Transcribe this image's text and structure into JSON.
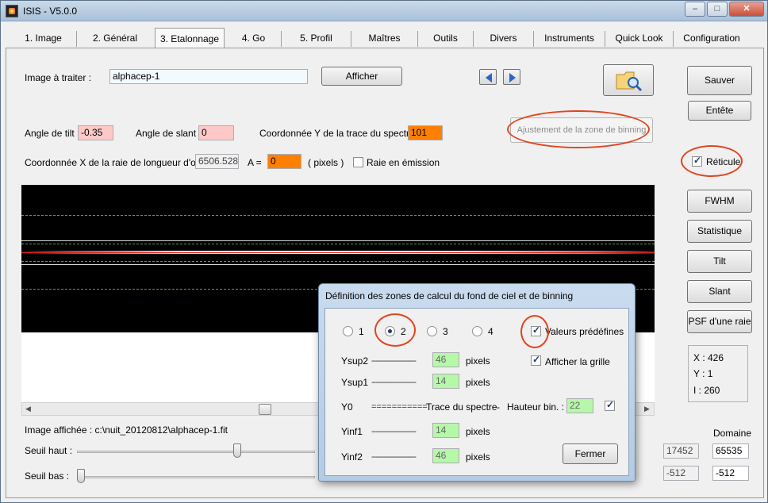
{
  "window": {
    "title": "ISIS - V5.0.0",
    "min": "–",
    "max": "□",
    "close": "✕"
  },
  "tabs": [
    "1. Image",
    "2. Général",
    "3. Etalonnage",
    "4. Go",
    "5. Profil",
    "Maîtres",
    "Outils",
    "Divers",
    "Instruments",
    "Quick Look",
    "Configuration"
  ],
  "image": {
    "label": "Image à traiter :",
    "value": "alphacep-1",
    "show_button": "Afficher"
  },
  "angles": {
    "tilt_label": "Angle de tilt :",
    "tilt_value": "-0.35",
    "slant_label": "Angle de slant :",
    "slant_value": "0",
    "ytrace_label": "Coordonnée Y de la trace du spectre :",
    "ytrace_value": "101"
  },
  "binning_button": "Ajustement de la zone de binning",
  "wavelength": {
    "label": "Coordonnée X de la raie de longueur d'onde",
    "value": "6506.528",
    "a_label": "A  =",
    "a_value": "0",
    "pixels": "( pixels )",
    "emission_label": "Raie en émission"
  },
  "right_buttons": {
    "save": "Sauver",
    "header": "Entête",
    "reticule": "Réticule",
    "fwhm": "FWHM",
    "stat": "Statistique",
    "tilt": "Tilt",
    "slant": "Slant",
    "psf": "PSF d'une raie"
  },
  "info": {
    "x": "X : 426",
    "y": "Y : 1",
    "i": "I  : 260"
  },
  "displayed": "Image affichée : c:\\nuit_20120812\\alphacep-1.fit",
  "thresholds": {
    "high_label": "Seuil haut :",
    "low_label": "Seuil bas :",
    "high_value": "17452",
    "low_value": "-512",
    "domain_label": "Domaine",
    "domain_high": "65535",
    "domain_low": "-512",
    "high_level": 0.68,
    "low_level": 0.0
  },
  "dialog": {
    "title": "Définition des zones de calcul du fond de ciel et de binning",
    "radios": [
      "1",
      "2",
      "3",
      "4"
    ],
    "selected_radio": "2",
    "predefined": "Valeurs prédéfines",
    "show_grid": "Afficher la grille",
    "rows": {
      "ysup2": {
        "label": "Ysup2",
        "value": "46",
        "unit": "pixels"
      },
      "ysup1": {
        "label": "Ysup1",
        "value": "14",
        "unit": "pixels"
      },
      "y0": {
        "label": "Y0",
        "eq": "===========",
        "text": "Trace du spectre",
        "dash": "-",
        "hb_label": "Hauteur bin. :",
        "hb_value": "22"
      },
      "yinf1": {
        "label": "Yinf1",
        "value": "14",
        "unit": "pixels"
      },
      "yinf2": {
        "label": "Yinf2",
        "value": "46",
        "unit": "pixels"
      }
    },
    "dashes": "---------------------",
    "close_button": "Fermer"
  },
  "colors": {
    "annotation": "#e0451f",
    "pink_field": "#ffc8c8",
    "orange_field": "#ff8000",
    "green_field": "#b7f7a9"
  }
}
